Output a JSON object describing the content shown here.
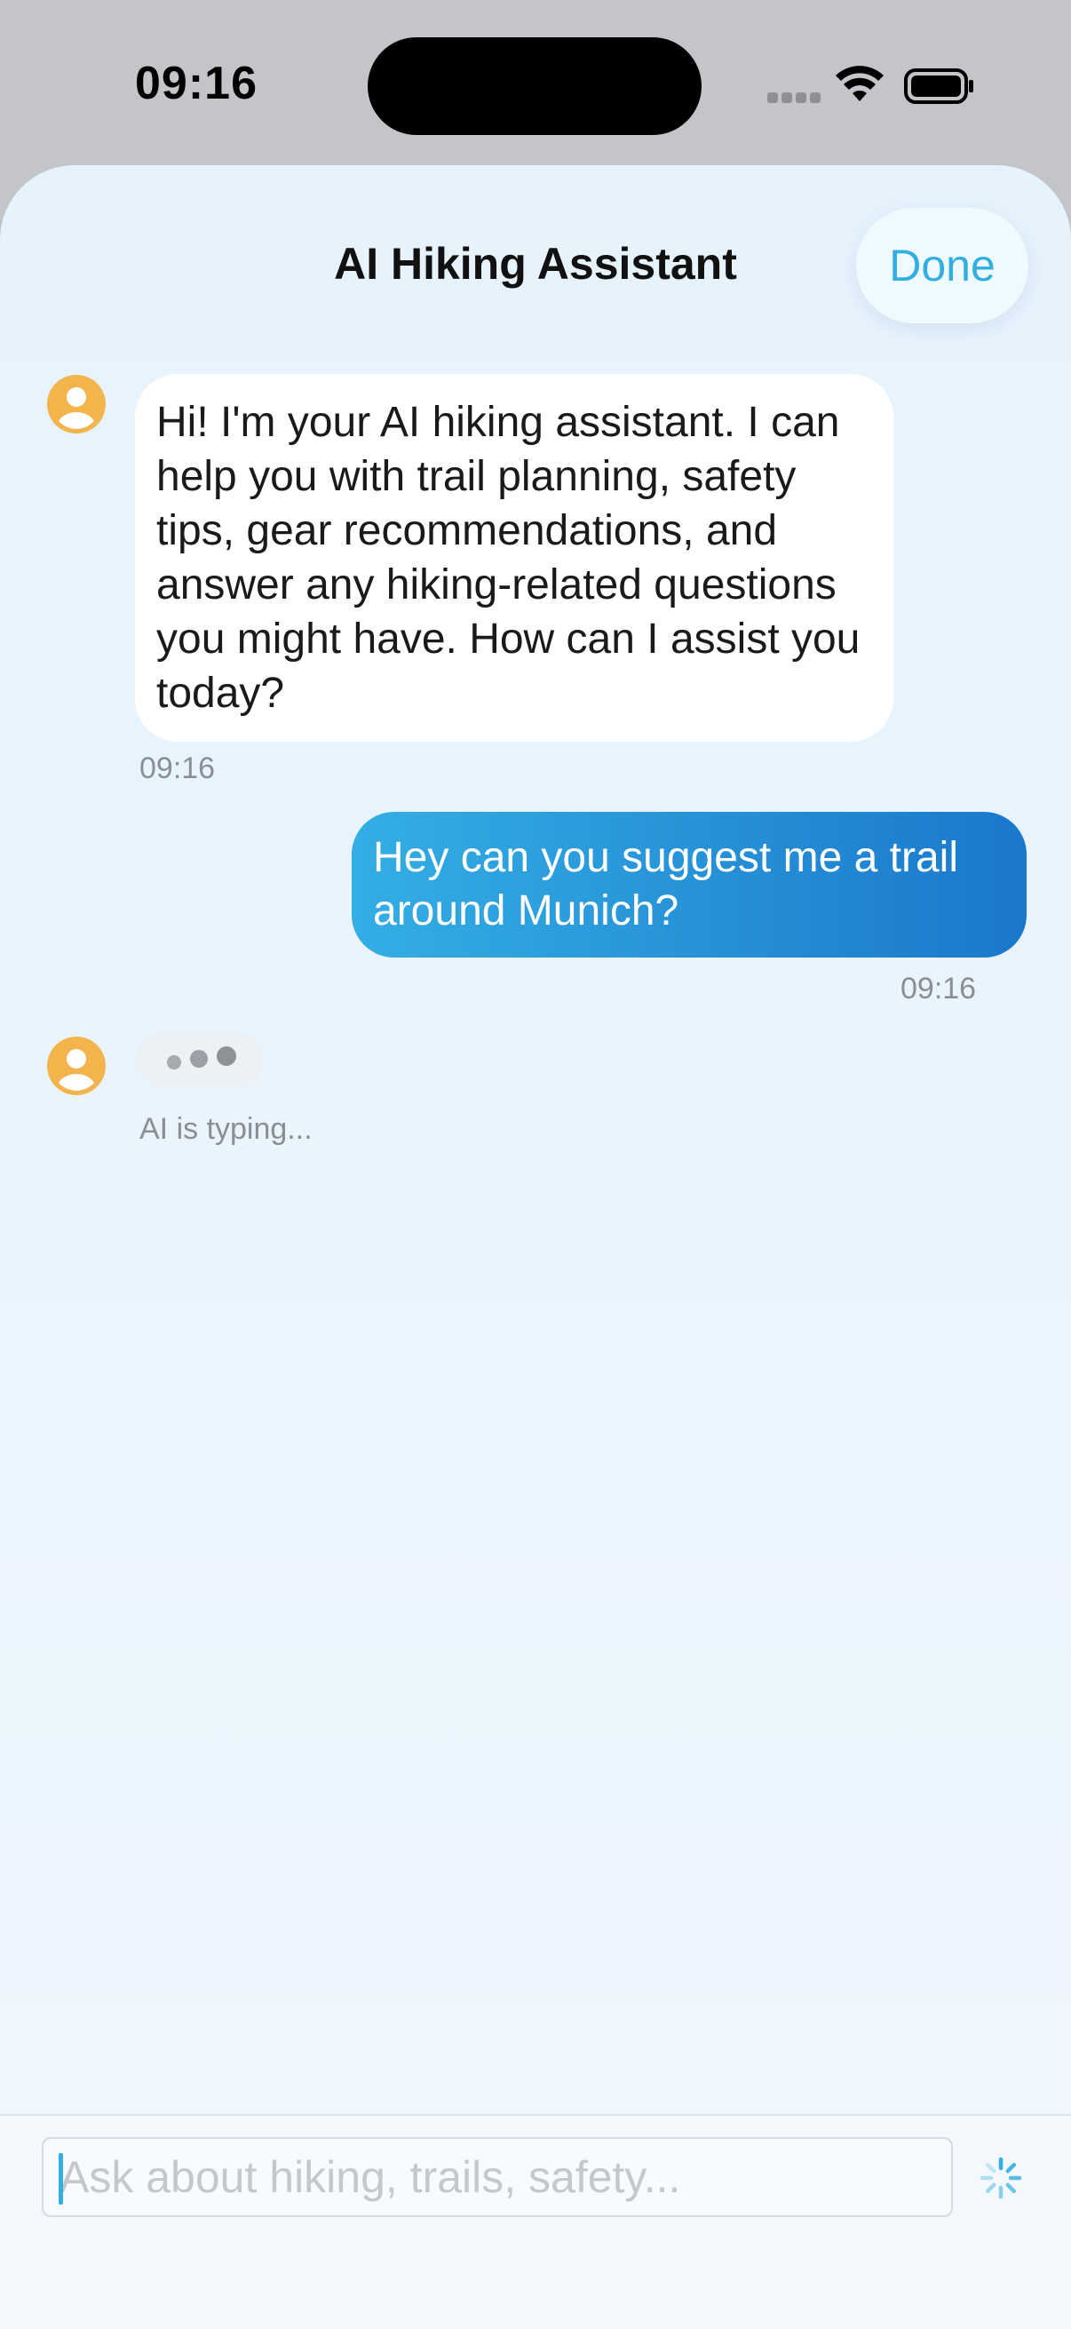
{
  "status_bar": {
    "time": "09:16"
  },
  "header": {
    "title": "AI Hiking Assistant",
    "done_label": "Done"
  },
  "messages": [
    {
      "role": "assistant",
      "text": "Hi! I'm your AI hiking assistant. I can help you with trail planning, safety tips, gear recommendations, and answer any hiking-related questions you might have. How can I assist you today?",
      "time": "09:16"
    },
    {
      "role": "user",
      "text": "Hey can you suggest me a trail around Munich?",
      "time": "09:16"
    }
  ],
  "typing": {
    "label": "AI is typing..."
  },
  "composer": {
    "placeholder": "Ask about hiking, trails, safety...",
    "value": ""
  },
  "colors": {
    "accent": "#33aee0",
    "user_bubble_start": "#34aee4",
    "user_bubble_end": "#1a78cc",
    "avatar": "#f3b44c",
    "sheet_background": "#e6f3fd"
  },
  "icons": {
    "avatar": "person-circle-icon",
    "send": "spinner-icon"
  }
}
